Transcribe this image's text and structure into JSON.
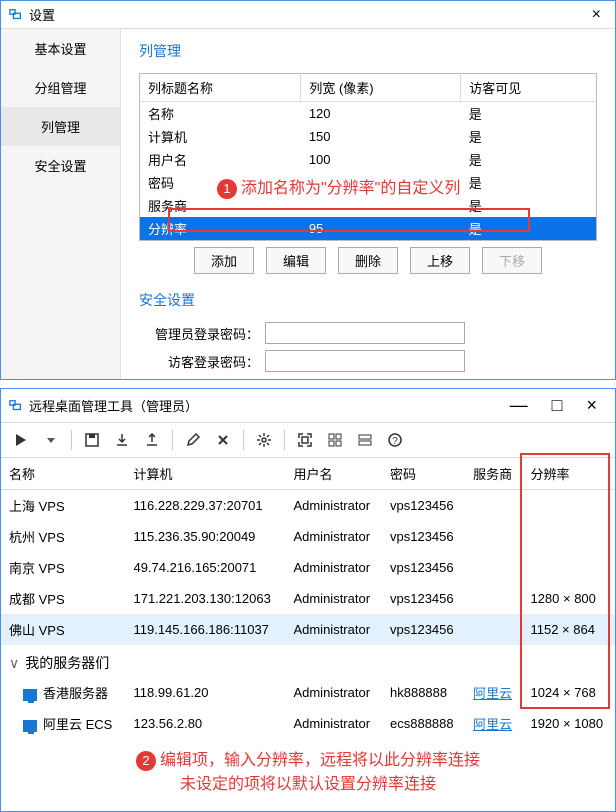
{
  "win1": {
    "title": "设置",
    "sidebar": {
      "items": [
        "基本设置",
        "分组管理",
        "列管理",
        "安全设置"
      ],
      "active": 2
    },
    "section1_title": "列管理",
    "col_headers": [
      "列标题名称",
      "列宽 (像素)",
      "访客可见"
    ],
    "col_rows": [
      {
        "name": "名称",
        "width": "120",
        "visible": "是"
      },
      {
        "name": "计算机",
        "width": "150",
        "visible": "是"
      },
      {
        "name": "用户名",
        "width": "100",
        "visible": "是"
      },
      {
        "name": "密码",
        "width": "",
        "visible": "是"
      },
      {
        "name": "服务商",
        "width": "",
        "visible": "是"
      },
      {
        "name": "分辨率",
        "width": "95",
        "visible": "是",
        "selected": true
      }
    ],
    "buttons": {
      "add": "添加",
      "edit": "编辑",
      "del": "删除",
      "up": "上移",
      "down": "下移"
    },
    "section2_title": "安全设置",
    "admin_pwd_label": "管理员登录密码：",
    "guest_pwd_label": "访客登录密码：",
    "annot1": "添加名称为\"分辨率\"的自定义列"
  },
  "win2": {
    "title": "远程桌面管理工具（管理员）",
    "headers": [
      "名称",
      "计算机",
      "用户名",
      "密码",
      "服务商",
      "分辨率"
    ],
    "rows": [
      {
        "name": "上海 VPS",
        "host": "116.228.229.37:20701",
        "user": "Administrator",
        "pwd": "vps123456",
        "prov": "",
        "res": ""
      },
      {
        "name": "杭州 VPS",
        "host": "115.236.35.90:20049",
        "user": "Administrator",
        "pwd": "vps123456",
        "prov": "",
        "res": ""
      },
      {
        "name": "南京 VPS",
        "host": "49.74.216.165:20071",
        "user": "Administrator",
        "pwd": "vps123456",
        "prov": "",
        "res": ""
      },
      {
        "name": "成都 VPS",
        "host": "171.221.203.130:12063",
        "user": "Administrator",
        "pwd": "vps123456",
        "prov": "",
        "res": "1280 × 800"
      },
      {
        "name": "佛山 VPS",
        "host": "119.145.166.186:11037",
        "user": "Administrator",
        "pwd": "vps123456",
        "prov": "",
        "res": "1152 × 864",
        "selected": true
      }
    ],
    "group_label": "我的服务器们",
    "group_rows": [
      {
        "name": "香港服务器",
        "host": "118.99.61.20",
        "user": "Administrator",
        "pwd": "hk888888",
        "prov": "阿里云",
        "res": "1024 × 768",
        "icon": true
      },
      {
        "name": "阿里云 ECS",
        "host": "123.56.2.80",
        "user": "Administrator",
        "pwd": "ecs888888",
        "prov": "阿里云",
        "res": "1920 × 1080",
        "icon": true
      }
    ],
    "annot2_line1": "编辑项，输入分辨率，远程将以此分辨率连接",
    "annot2_line2": "未设定的项将以默认设置分辨率连接"
  }
}
